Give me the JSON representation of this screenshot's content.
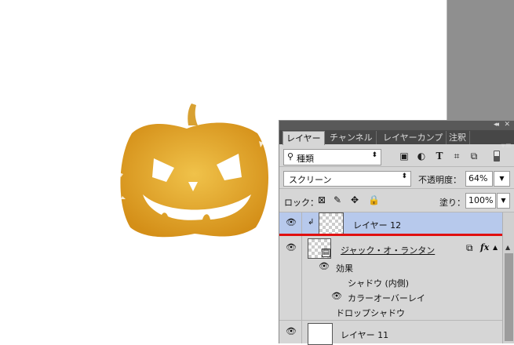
{
  "layers_panel": {
    "tabs": [
      "レイヤー",
      "チャンネル",
      "レイヤーカンプ",
      "注釈"
    ],
    "filter_kind": "種類",
    "blend_mode": "スクリーン",
    "opacity_label": "不透明度：",
    "opacity_value": "64%",
    "lock_label": "ロック：",
    "fill_label": "塗り：",
    "fill_value": "100%",
    "layers": [
      {
        "name": "レイヤー 12",
        "visible": true,
        "selected": true,
        "clipped": true
      },
      {
        "name": "ジャック・オ・ランタン",
        "visible": true,
        "smart_object": true,
        "effects_label": "効果",
        "effects": [
          {
            "name": "シャドウ (内側)",
            "visible": false
          },
          {
            "name": "カラーオーバーレイ",
            "visible": true
          },
          {
            "name": "ドロップシャドウ",
            "visible": false
          }
        ]
      },
      {
        "name": "レイヤー 11",
        "visible": true
      }
    ],
    "fx_label": "fx"
  },
  "colors": {
    "selection": "#b7c9ec",
    "drop_indicator": "#e01010",
    "pumpkin": "#e2a326"
  },
  "icons": [
    "search-icon",
    "image-filter-icon",
    "adjustment-filter-icon",
    "type-filter-icon",
    "shape-filter-icon",
    "smart-object-filter-icon",
    "lock-pixels-icon",
    "lock-paint-icon",
    "lock-position-icon",
    "lock-all-icon",
    "eye-icon",
    "clipping-arrow-icon",
    "fx-icon",
    "link-icon"
  ]
}
